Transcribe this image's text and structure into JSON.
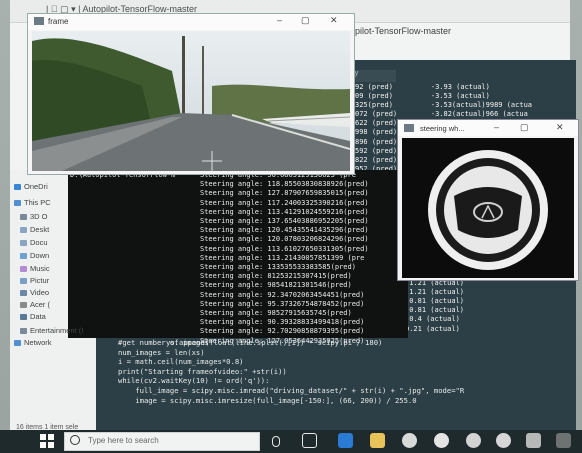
{
  "explorer": {
    "title": "| ⃞ ▢ ▾ | Autopilot-TensorFlow-master",
    "repo_title": "pilot-TensorFlow-master",
    "nav_items": [
      "OneDri",
      "This PC",
      "3D O",
      "Deskt",
      "Docu",
      "Down",
      "Music",
      "Pictur",
      "Video",
      "Acer (",
      "Data",
      "Entertainment (I",
      "Network"
    ],
    "status": "16 items    1 item sele"
  },
  "editor": {
    "tab_label": "ilot.py",
    "code_lines": [
      "#get number of images",
      "num_images = len(xs)",
      "",
      "i = math.ceil(num_images*0.8)",
      "print(\"Starting frameofvideo:\" +str(i))",
      "",
      "while(cv2.waitKey(10) != ord('q')):",
      "    full_image = scipy.misc.imread(\"driving_dataset/\" + str(i) + \".jpg\", mode=\"R",
      "    image = scipy.misc.imresize(full_image[-150:], (66, 200)) / 255.0"
    ],
    "partial_lines": [
      "#the pe",
      "#but ac",
      "#so the",
      "ys.append(float(line.split()[1]) * scipy.pi / 180)"
    ]
  },
  "predictions": [
    "92 (pred)         -3.93 (actual)",
    "09 (pred)         -3.53 (actual)",
    "325(pred)         -3.53(actual)9989 (actua",
    "072 (pred)        -3.82(actual)966 (actua",
    "622 (pred)        -3.93 (actual)",
    "998 (pred)",
    "896 (pred)",
    "592 (pred)",
    "822 (pred)",
    "952 (pred)"
  ],
  "predictions_low": [
    "-1.21 (actual)",
    "-1.21 (actual)",
    ":1.21 (actual)",
    "-0.81 (actual)",
    "-0.81 (actual)",
    "-0.4 (actual)",
    "0.21 (actual)"
  ],
  "terminal": {
    "path": "D:\\Autopilot-TensorFlow-m",
    "lines": [
      "Steering angle: 56.0865129138623 (pre",
      "Steering angle: 118.85503830838926(pred)",
      "Steering angle: 127.87907659835015(pred)",
      "Steering angle: 117.24003325390216(pred)",
      "Steering angle: 113.41291024559216(pred)",
      "Steering angle: 137.65403886952205(pred)",
      "Steering angle: 120.45435541435296(pred)",
      "Steering angle: 120.07803206824296(pred)",
      "Steering angle: 113.61027650331305(pred)",
      "Steering angle: 113.21430057851399 (pre",
      "Steering angle: 133535533383585(pred)",
      "Steering angle: 81253215307415(pred)",
      "Steering angle: 98541821301546(pred)",
      "Steering angle: 92.34702063454451(pred)",
      "Steering angle: 95.37326754878452(pred)",
      "Steering angle: 98527915635745(pred)",
      "Steering angle: 90.39328833499418(pred)",
      "Steering angle: 92.70290858879395(pred)",
      "Steering angle: 127.0536442935925(pred)"
    ]
  },
  "frame_window": {
    "title": "frame"
  },
  "steer_window": {
    "title": "steering wh..."
  },
  "taskbar": {
    "search_placeholder": "Type here to search"
  },
  "colors": {
    "taskbar": "#1f2a2c",
    "terminal": "#101211",
    "editor": "#2c3e46"
  }
}
